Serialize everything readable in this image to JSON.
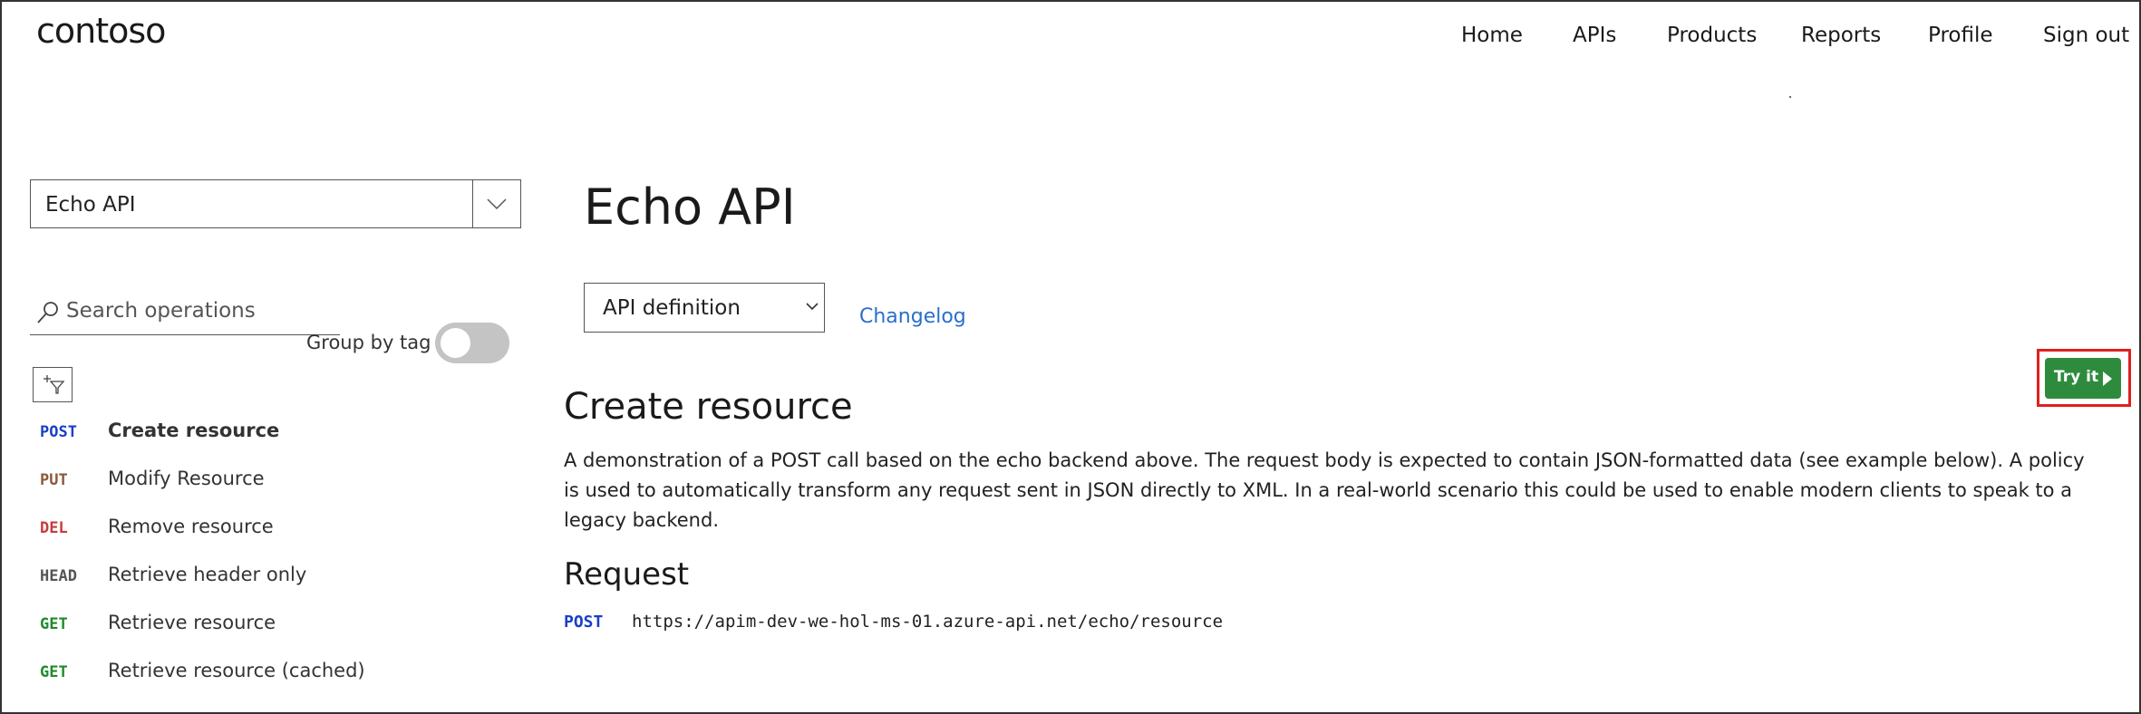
{
  "brand": {
    "logo_text": "contoso"
  },
  "nav": {
    "items": [
      "Home",
      "APIs",
      "Products",
      "Reports",
      "Profile",
      "Sign out"
    ]
  },
  "sidebar": {
    "api_select_value": "Echo API",
    "search_placeholder": "Search operations",
    "group_by_tag_label": "Group by tag",
    "group_by_tag_on": false,
    "operations": [
      {
        "method": "POST",
        "name": "Create resource",
        "color": "#1a3fc9",
        "active": true
      },
      {
        "method": "PUT",
        "name": "Modify Resource",
        "color": "#8a5a3c",
        "active": false
      },
      {
        "method": "DEL",
        "name": "Remove resource",
        "color": "#c93a3a",
        "active": false
      },
      {
        "method": "HEAD",
        "name": "Retrieve header only",
        "color": "#555555",
        "active": false
      },
      {
        "method": "GET",
        "name": "Retrieve resource",
        "color": "#1f8a2e",
        "active": false
      },
      {
        "method": "GET",
        "name": "Retrieve resource (cached)",
        "color": "#1f8a2e",
        "active": false
      }
    ]
  },
  "main": {
    "title": "Echo API",
    "definition_select_value": "API definition",
    "changelog_link": "Changelog",
    "try_it_label": "Try it",
    "operation_title": "Create resource",
    "description": "A demonstration of a POST call based on the echo backend above. The request body is expected to contain JSON-formatted data (see example below). A policy is used to automatically transform any request sent in JSON directly to XML. In a real-world scenario this could be used to enable modern clients to speak to a legacy backend.",
    "request_title": "Request",
    "request_method": "POST",
    "request_url": "https://apim-dev-we-hol-ms-01.azure-api.net/echo/resource"
  },
  "colors": {
    "accent_green": "#2e8b3e",
    "highlight_red": "#e01f1f",
    "link_blue": "#2a6fc9"
  }
}
